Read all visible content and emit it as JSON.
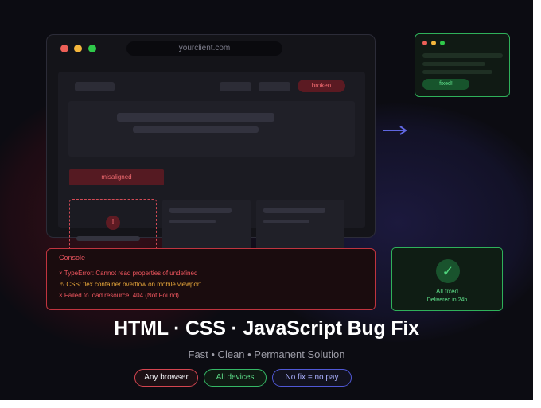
{
  "browser": {
    "url": "yourclient.com",
    "broken_label": "broken",
    "misaligned_label": "misaligned",
    "error_icon_glyph": "!"
  },
  "mini_window": {
    "fixed_label": "fixed!"
  },
  "console": {
    "title": "Console",
    "lines": [
      {
        "text": "× TypeError: Cannot read properties of undefined",
        "level": "error"
      },
      {
        "text": "⚠ CSS: flex container overflow on mobile viewport",
        "level": "warning"
      },
      {
        "text": "× Failed to load resource: 404 (Not Found)",
        "level": "error"
      }
    ]
  },
  "status": {
    "check_glyph": "✓",
    "title": "All fixed",
    "subtitle": "Delivered in 24h"
  },
  "headline": "HTML · CSS · JavaScript Bug Fix",
  "tagline": "Fast • Clean • Permanent Solution",
  "badges": {
    "browser": "Any browser",
    "devices": "All devices",
    "guarantee": "No fix = no pay"
  },
  "colors": {
    "background": "#0c0c12",
    "error": "#e5545e",
    "warning": "#e8a73a",
    "success": "#5ee08a",
    "accent_blue": "#5058d6",
    "traffic_red": "#ec5f57",
    "traffic_yellow": "#f4b63c",
    "traffic_green": "#2fc94a"
  }
}
